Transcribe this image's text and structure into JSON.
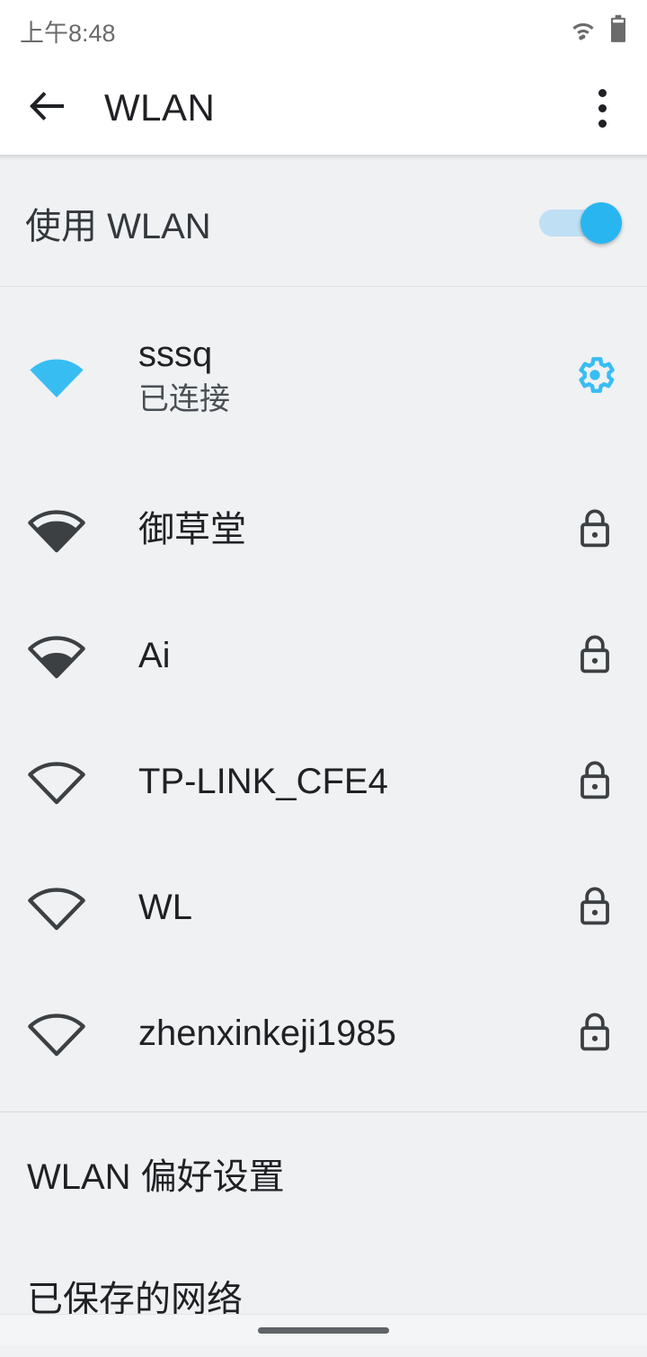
{
  "status_bar": {
    "time": "上午8:48",
    "wifi_icon": "wifi-icon",
    "battery_icon": "battery-icon"
  },
  "app_bar": {
    "back_icon": "back-arrow-icon",
    "title": "WLAN",
    "overflow_icon": "overflow-menu-icon"
  },
  "master_toggle": {
    "label": "使用 WLAN",
    "state": "on"
  },
  "networks": [
    {
      "name": "sssq",
      "status": "已连接",
      "signal": "full",
      "secured": false,
      "connected": true,
      "right_icon": "settings-gear-icon"
    },
    {
      "name": "御草堂",
      "status": "",
      "signal": "three",
      "secured": true,
      "connected": false,
      "right_icon": "lock-icon"
    },
    {
      "name": "Ai",
      "status": "",
      "signal": "two",
      "secured": true,
      "connected": false,
      "right_icon": "lock-icon"
    },
    {
      "name": "TP-LINK_CFE4",
      "status": "",
      "signal": "one",
      "secured": true,
      "connected": false,
      "right_icon": "lock-icon"
    },
    {
      "name": "WL",
      "status": "",
      "signal": "one",
      "secured": true,
      "connected": false,
      "right_icon": "lock-icon"
    },
    {
      "name": "zhenxinkeji1985",
      "status": "",
      "signal": "one",
      "secured": true,
      "connected": false,
      "right_icon": "lock-icon"
    }
  ],
  "footer": {
    "items": [
      {
        "label": "WLAN 偏好设置"
      },
      {
        "label": "已保存的网络"
      }
    ]
  },
  "nav_bar": {
    "gesture_pill": "home-gesture-pill"
  },
  "colors": {
    "accent": "#29b6f0",
    "track": "#bfdff4",
    "background": "#eff1f3",
    "appbar": "#ffffff",
    "text_primary": "#202124",
    "text_secondary": "#4a4f54",
    "icon_dark": "#3c4043",
    "status_icon": "#6b6b6b"
  }
}
